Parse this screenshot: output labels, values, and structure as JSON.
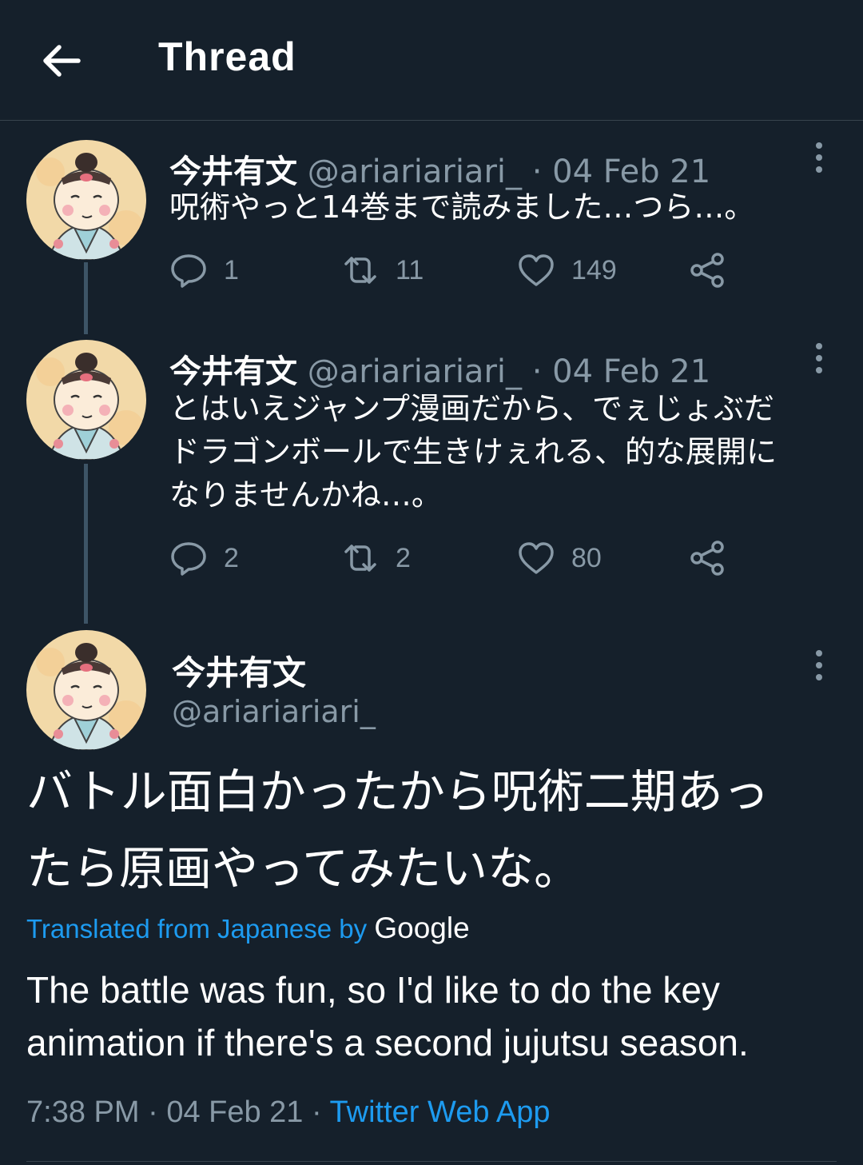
{
  "header": {
    "title": "Thread"
  },
  "tweets": [
    {
      "name": "今井有文",
      "handle": "@ariariariari_",
      "date": "04 Feb 21",
      "text": "呪術やっと14巻まで読みました…つら…。",
      "replies": "1",
      "retweets": "11",
      "likes": "149"
    },
    {
      "name": "今井有文",
      "handle": "@ariariariari_",
      "date": "04 Feb 21",
      "text_lines": [
        "とはいえジャンプ漫画だから、でぇじょぶだ",
        "ドラゴンボールで生きけぇれる、的な展開に",
        "なりませんかね…。"
      ],
      "replies": "2",
      "retweets": "2",
      "likes": "80"
    }
  ],
  "main_tweet": {
    "name": "今井有文",
    "handle": "@ariariariari_",
    "text_lines": [
      "バトル面白かったから呪術二期あっ",
      "たら原画やってみたいな。"
    ],
    "translated_label": "Translated from Japanese by ",
    "translated_provider": "Google",
    "translation_lines": [
      "The battle was fun, so I'd like to do the key",
      "animation if there's a second jujutsu season."
    ],
    "time": "7:38 PM",
    "date": "04 Feb 21",
    "app": "Twitter Web App"
  },
  "colors": {
    "background": "#15202b",
    "accent": "#1d9bf0",
    "muted": "#8899a6"
  },
  "icons": [
    "back-arrow-icon",
    "more-vertical-icon",
    "reply-icon",
    "retweet-icon",
    "like-icon",
    "share-icon"
  ]
}
